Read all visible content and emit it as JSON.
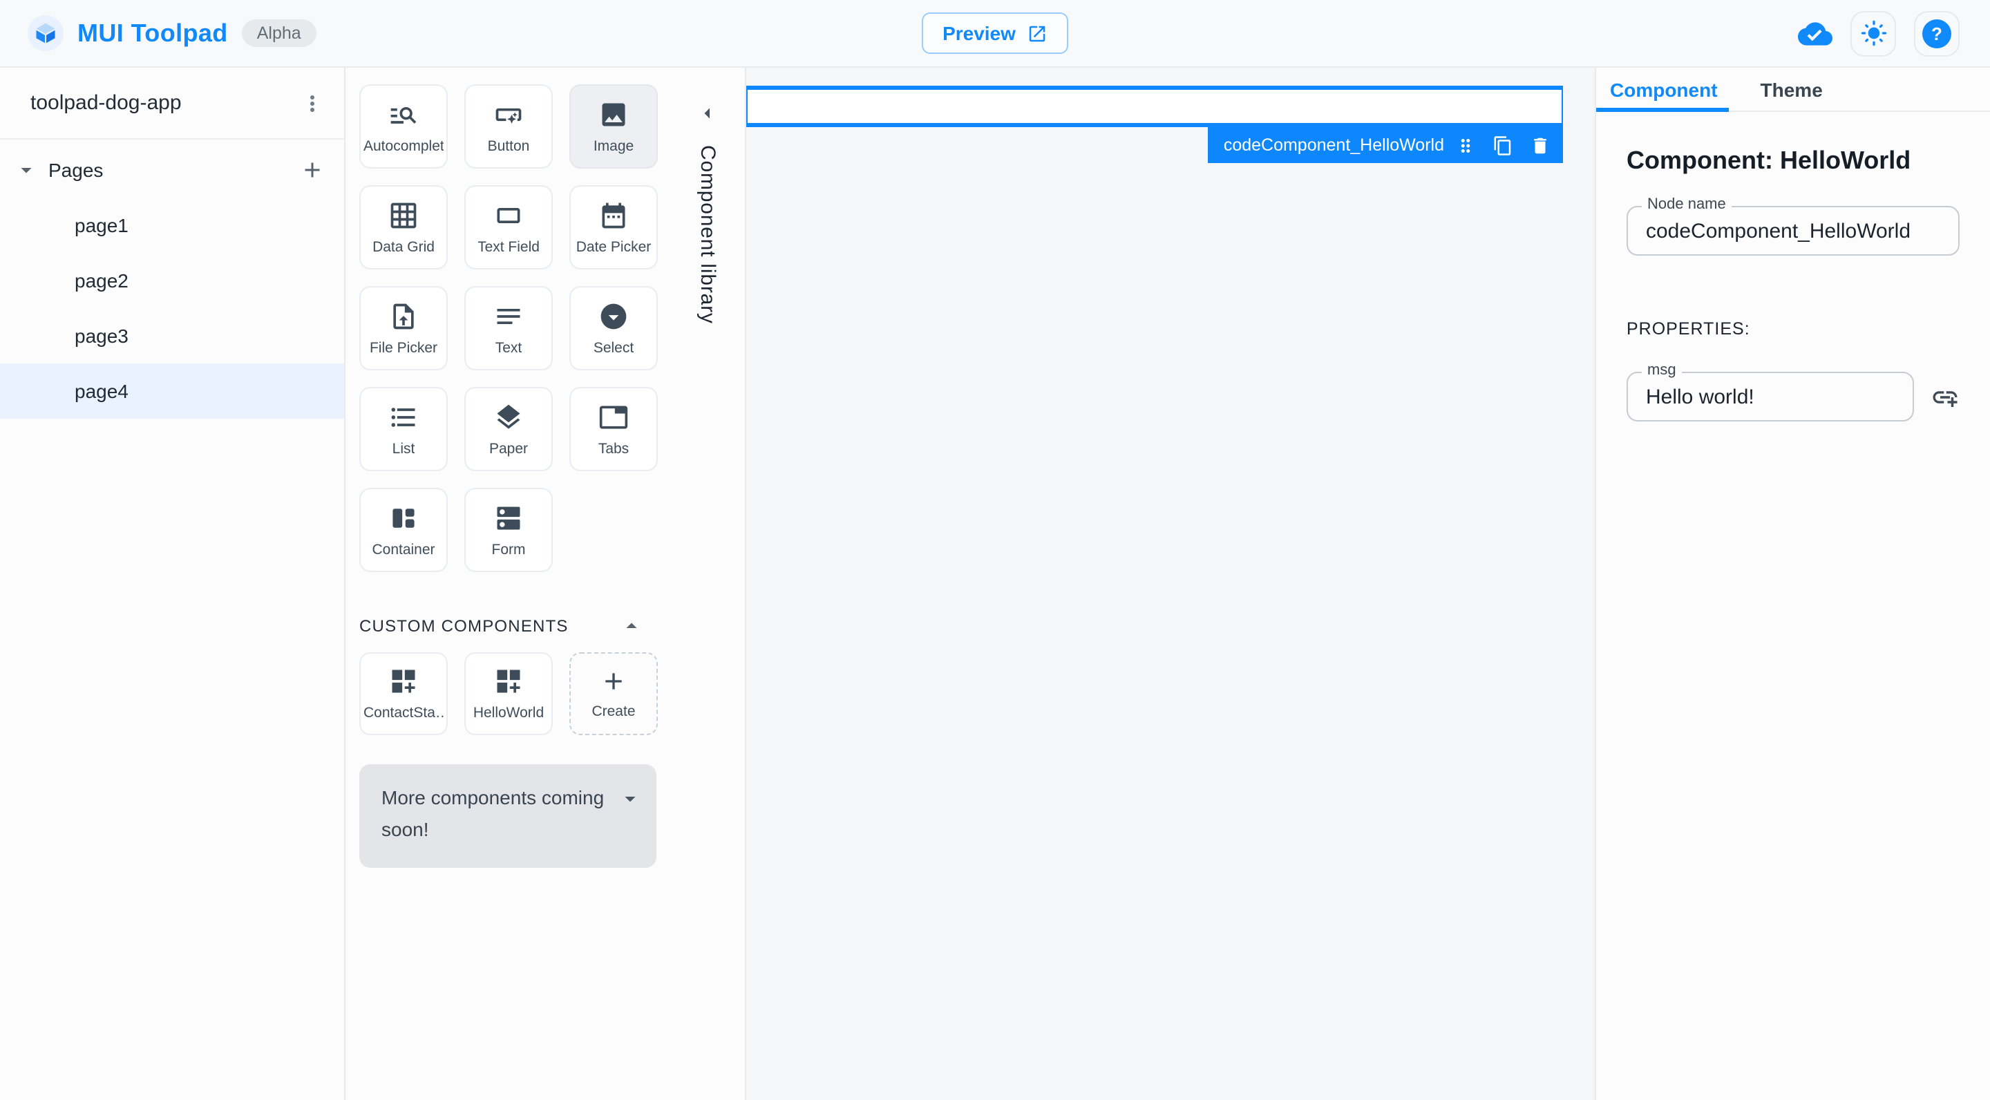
{
  "topbar": {
    "title": "MUI Toolpad",
    "badge": "Alpha",
    "preview_label": "Preview"
  },
  "sidebar": {
    "app_name": "toolpad-dog-app",
    "pages_label": "Pages",
    "pages": [
      {
        "label": "page1"
      },
      {
        "label": "page2"
      },
      {
        "label": "page3"
      },
      {
        "label": "page4"
      }
    ]
  },
  "library": {
    "rail_label": "Component library",
    "items": [
      {
        "label": "Autocomplete"
      },
      {
        "label": "Button"
      },
      {
        "label": "Image"
      },
      {
        "label": "Data Grid"
      },
      {
        "label": "Text Field"
      },
      {
        "label": "Date Picker"
      },
      {
        "label": "File Picker"
      },
      {
        "label": "Text"
      },
      {
        "label": "Select"
      },
      {
        "label": "List"
      },
      {
        "label": "Paper"
      },
      {
        "label": "Tabs"
      },
      {
        "label": "Container"
      },
      {
        "label": "Form"
      }
    ],
    "custom_header": "CUSTOM COMPONENTS",
    "custom_items": [
      {
        "label": "ContactSta…"
      },
      {
        "label": "HelloWorld"
      },
      {
        "label": "Create"
      }
    ],
    "more_note": "More components coming soon!"
  },
  "canvas": {
    "selected_node_label": "codeComponent_HelloWorld"
  },
  "inspector": {
    "tab_component": "Component",
    "tab_theme": "Theme",
    "heading": "Component: HelloWorld",
    "node_name_label": "Node name",
    "node_name_value": "codeComponent_HelloWorld",
    "properties_label": "PROPERTIES:",
    "msg_label": "msg",
    "msg_value": "Hello world!",
    "help_label": "?"
  },
  "colors": {
    "accent_blue": "#1089fa",
    "selection_blue": "#0d87fb",
    "icon_slate": "#3e4c59",
    "active_page_bg": "#e9f2fe"
  }
}
